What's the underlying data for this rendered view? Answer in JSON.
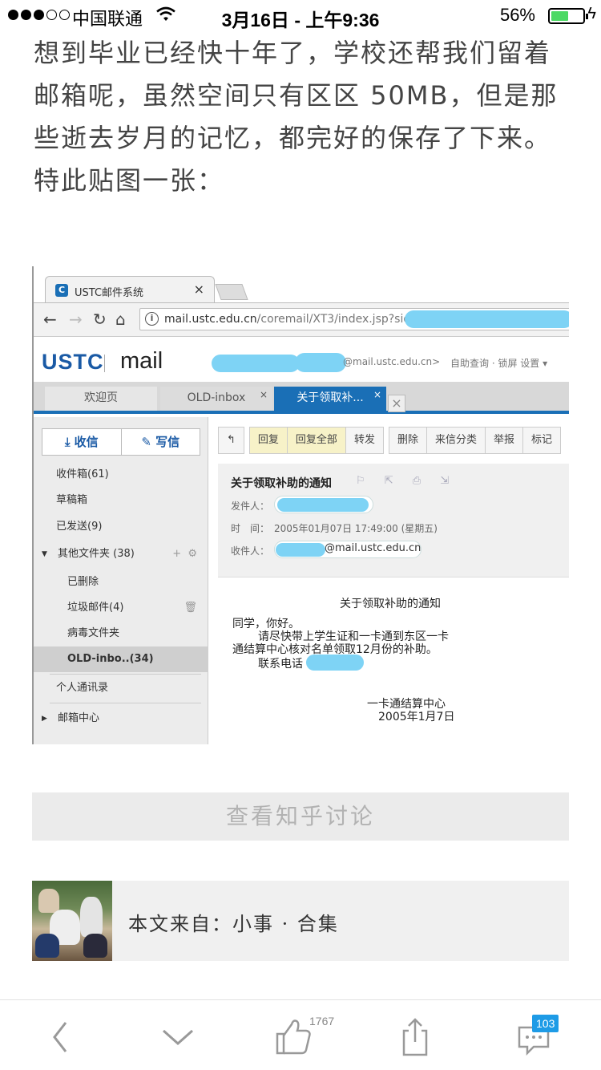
{
  "status_bar": {
    "carrier": "中国联通",
    "time": "3月16日 - 上午9:36",
    "battery_percent": "56%",
    "battery_level": 0.56,
    "signal_bars_filled": 3,
    "signal_bars_total": 5
  },
  "article": {
    "lines": [
      "想到毕业已经快十年了，学校还帮我们留着",
      "邮箱呢，虽然空间只有区区 50MB，但是那",
      "些逝去岁月的记忆，都完好的保存了下来。",
      "特此贴图一张："
    ]
  },
  "screenshot": {
    "browser_tab_title": "USTC邮件系统",
    "browser_tab_close": "×",
    "favicon_letter": "C",
    "url_host": "mail.ustc.edu.cn",
    "url_path": "/coremail/XT3/index.jsp?sid=",
    "logo_left": "USTC",
    "logo_right": "mail",
    "user_email_suffix": "@mail.ustc.edu.cn>",
    "header_links": "自助查询 · 锁屏  设置 ▾",
    "mail_tabs": [
      {
        "label": "欢迎页",
        "close": ""
      },
      {
        "label": "OLD-inbox",
        "close": "×"
      },
      {
        "label": "关于领取补...",
        "close": "×"
      }
    ],
    "compose": {
      "receive": "收信",
      "write": "写信"
    },
    "folders": [
      {
        "label": "收件箱(61)"
      },
      {
        "label": "草稿箱"
      },
      {
        "label": "已发送(9)"
      },
      {
        "label": "其他文件夹 (38)"
      },
      {
        "label": "已删除"
      },
      {
        "label": "垃圾邮件(4)"
      },
      {
        "label": "病毒文件夹"
      },
      {
        "label": "OLD-inbo..(34)"
      },
      {
        "label": "个人通讯录"
      },
      {
        "label": "邮箱中心"
      }
    ],
    "toolbar": [
      "回复",
      "回复全部",
      "转发",
      "删除",
      "来信分类",
      "举报",
      "标记"
    ],
    "message": {
      "subject": "关于领取补助的通知",
      "sender_label": "发件人：",
      "time_label": "时　间：",
      "time_value": "2005年01月07日 17:49:00 (星期五)",
      "recipient_label": "收件人：",
      "recipient_suffix": "@mail.ustc.edu.cn",
      "body_title": "关于领取补助的通知",
      "body_lines": [
        "同学，你好。",
        "请尽快带上学生证和一卡通到东区一卡",
        "通结算中心核对名单领取12月份的补助。",
        "联系电话"
      ],
      "signature": "一卡通结算中心",
      "date": "2005年1月7日"
    }
  },
  "discuss_button": "查看知乎讨论",
  "source": {
    "text": "本文来自：小事 · 合集"
  },
  "bottom_bar": {
    "like_count": "1767",
    "comment_count": "103",
    "icons": [
      "back-icon",
      "chevron-down-icon",
      "thumbs-up-icon",
      "share-icon",
      "comment-icon"
    ]
  },
  "colors": {
    "accent_blue": "#1a6fb6",
    "blur_blue": "#7ed3f5",
    "battery_green": "#4cd964",
    "badge_blue": "#1e9be6"
  }
}
